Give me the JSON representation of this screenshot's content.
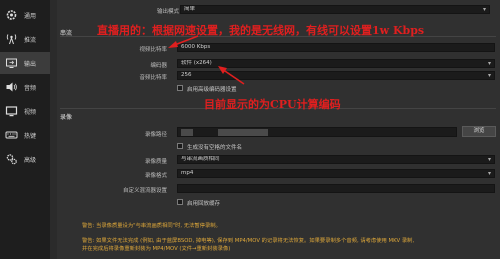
{
  "sidebar": {
    "items": [
      {
        "label": "通用",
        "icon": "gear-icon"
      },
      {
        "label": "推流",
        "icon": "broadcast-antenna-icon"
      },
      {
        "label": "输出",
        "icon": "monitor-output-icon"
      },
      {
        "label": "音频",
        "icon": "speaker-icon"
      },
      {
        "label": "视频",
        "icon": "display-icon"
      },
      {
        "label": "热键",
        "icon": "keyboard-icon"
      },
      {
        "label": "高级",
        "icon": "advanced-gear-icon"
      }
    ],
    "active_index": 2
  },
  "output": {
    "mode_label": "输出模式",
    "mode_value": "简单",
    "streaming": {
      "title": "串流",
      "bitrate_label": "视频比特率",
      "bitrate_value": "6000 Kbps",
      "encoder_label": "编码器",
      "encoder_value": "软件 (x264)",
      "audio_label": "音频比特率",
      "audio_value": "256",
      "advanced_checkbox": "启用高级编码器设置"
    },
    "recording": {
      "title": "录像",
      "path_label": "录像路径",
      "browse_button": "浏览",
      "no_space_checkbox": "生成没有空格的文件名",
      "quality_label": "录像质量",
      "quality_value": "与串流画质相同",
      "format_label": "录像格式",
      "format_value": "mp4",
      "mux_label": "自定义混流器设置",
      "replay_checkbox": "启用回放缓存"
    },
    "warnings": {
      "line1": "警告: 当录像质量设为\"与串流画质相同\"时, 无法暂停录制。",
      "line2": "警告: 如果文件无法完成 (例如, 由于蓝屏BSOD, 掉电等), 保存到 MP4/MOV 的记录将无法恢复。如果要录制多个音频, 请考虑使用 MKV 录制,",
      "line3": "并在完成后将录像重新封装为 MP4/MOV (文件→重新封装录像)"
    }
  },
  "annotations": {
    "bitrate_note": "直播用的：根据网速设置，我的是无线网，有线可以设置1w Kbps",
    "encoder_note": "目前显示的为CPU计算编码"
  },
  "colors": {
    "annotation": "#e01f1f",
    "warning": "#e0a93a",
    "sidebar_bg": "#1e1e1e",
    "panel_bg": "#303030"
  }
}
